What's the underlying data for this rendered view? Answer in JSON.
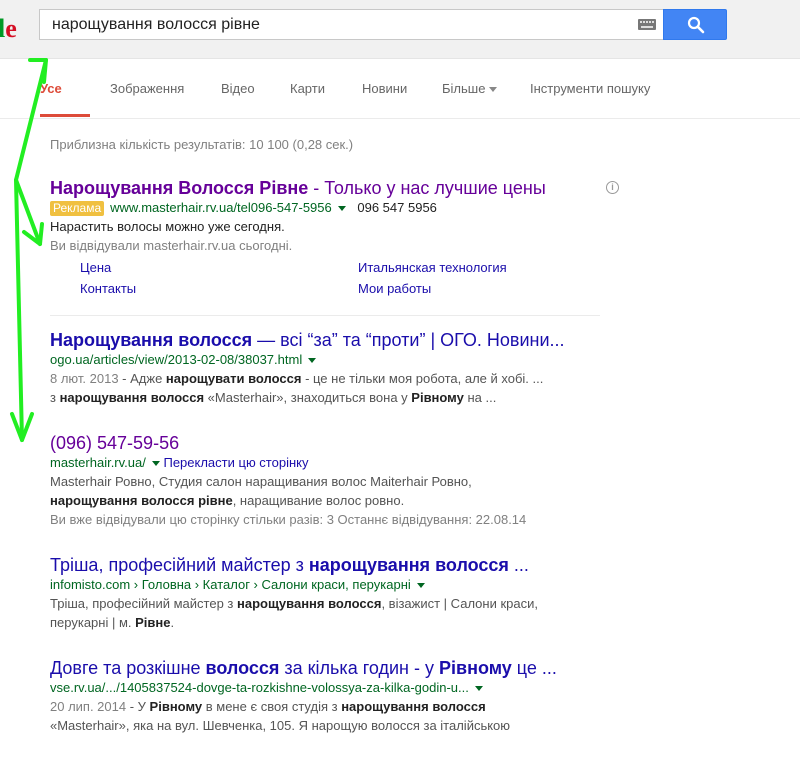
{
  "header": {
    "logo_fragment_l": "l",
    "logo_fragment_e": "e",
    "search_value": "нарощування волосся рівне"
  },
  "nav": {
    "items": [
      "Усе",
      "Зображення",
      "Відео",
      "Карти",
      "Новини",
      "Більше",
      "Інструменти пошуку"
    ]
  },
  "stats": "Приблизна кількість результатів: 10 100 (0,28 сек.)",
  "ad": {
    "title_bold": "Нарощування Волосся Рівне",
    "title_rest": " - Только у нас лучшие цены",
    "badge": "Реклама",
    "url": "www.masterhair.rv.ua/tel096-547-5956",
    "phone": "096 547 5956",
    "line1": "Нарастить волосы можно уже сегодня.",
    "line2": "Ви відвідували masterhair.rv.ua сьогодні.",
    "sitelinks": [
      "Цена",
      "Итальянская технология",
      "Контакты",
      "Мои работы"
    ]
  },
  "results": [
    {
      "title_a": "Нарощування волосся",
      "title_b": " — всі “за” та “проти” | ОГО. Новини...",
      "url": "ogo.ua/articles/view/2013-02-08/38037.html",
      "s1_date": "8 лют. 2013",
      "s1_a": " - Адже ",
      "s1_b": "нарощувати волосся",
      "s1_c": " - це не тільки моя робота, але й хобі. ...",
      "s2_a": "з ",
      "s2_b": "нарощування волосся",
      "s2_c": " «Masterhair», знаходиться вона у ",
      "s2_d": "Рівному",
      "s2_e": " на ..."
    },
    {
      "title": "(096) 547-59-56",
      "url": "masterhair.rv.ua/",
      "translate": "Перекласти цю сторінку",
      "s1": "Masterhair Ровно, Студия салон наращивания волос Maiterhair Ровно,",
      "s2_b": "нарощування волосся рівне",
      "s2_c": ", наращивание волос ровно.",
      "s3": "Ви вже відвідували цю сторінку стільки разів: 3 Останнє відвідування: 22.08.14"
    },
    {
      "title_a": "Тріша, професійний майстер з ",
      "title_b": "нарощування волосся",
      "title_c": " ...",
      "url": "infomisto.com › Головна › Каталог › Салони краси, перукарні",
      "s1_a": "Тріша, професійний майстер з ",
      "s1_b": "нарощування волосся",
      "s1_c": ", візажист | Салони краси,",
      "s2_a": "перукарні | м. ",
      "s2_b": "Рівне",
      "s2_c": "."
    },
    {
      "title_a": "Довге та розкішне ",
      "title_b": "волосся",
      "title_c": " за кілька годин - у ",
      "title_d": "Рівному",
      "title_e": " це ...",
      "url": "vse.rv.ua/.../1405837524-dovge-ta-rozkishne-volossya-za-kilka-godin-u...",
      "s1_date": "20 лип. 2014",
      "s1_a": " - У ",
      "s1_b": "Рівному",
      "s1_c": " в мене є своя студія з ",
      "s1_d": "нарощування волосся",
      "s2": "«Masterhair», яка на вул. Шевченка, 105. Я нарощую волосся за італійською"
    }
  ],
  "colors": {
    "annotation_arrow": "#22ee22",
    "link": "#1a0dab",
    "visited": "#660099",
    "url_green": "#006621",
    "search_button": "#4285f4",
    "active_tab": "#dd4b39"
  }
}
